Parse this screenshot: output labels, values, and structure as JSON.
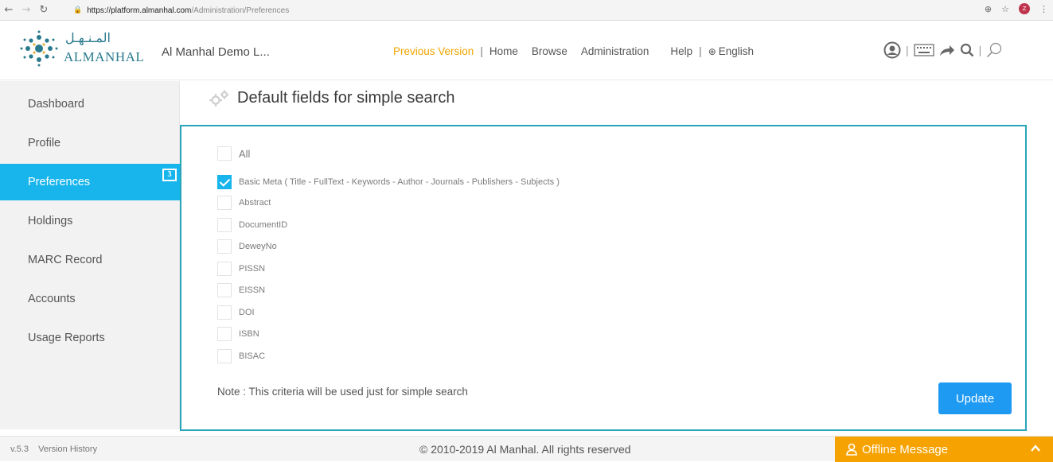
{
  "browser": {
    "url_host": "https://platform.almanhal.com",
    "url_path": "/Administration/Preferences",
    "profile_initial": "Z"
  },
  "header": {
    "logo_ar": "المـنـهـل",
    "logo_en": "ALMANHAL",
    "institution": "Al Manhal Demo L...",
    "nav": {
      "previous": "Previous Version",
      "home": "Home",
      "browse": "Browse",
      "administration": "Administration",
      "help": "Help",
      "language": "English"
    }
  },
  "sidebar": {
    "items": [
      {
        "label": "Dashboard"
      },
      {
        "label": "Profile"
      },
      {
        "label": "Preferences"
      },
      {
        "label": "Holdings"
      },
      {
        "label": "MARC Record"
      },
      {
        "label": "Accounts"
      },
      {
        "label": "Usage Reports"
      }
    ],
    "active_index": 2,
    "badge": "3"
  },
  "main": {
    "title": "Default fields for simple search",
    "fields": [
      {
        "label": "All",
        "checked": false
      },
      {
        "label": "Basic Meta ( Title - FullText - Keywords - Author - Journals - Publishers - Subjects )",
        "checked": true
      },
      {
        "label": "Abstract",
        "checked": false
      },
      {
        "label": "DocumentID",
        "checked": false
      },
      {
        "label": "DeweyNo",
        "checked": false
      },
      {
        "label": "PISSN",
        "checked": false
      },
      {
        "label": "EISSN",
        "checked": false
      },
      {
        "label": "DOI",
        "checked": false
      },
      {
        "label": "ISBN",
        "checked": false
      },
      {
        "label": "BISAC",
        "checked": false
      }
    ],
    "note": "Note : This criteria will be used just for simple search",
    "update_label": "Update"
  },
  "footer": {
    "version": "v.5.3",
    "version_history": "Version History",
    "copyright": "© 2010-2019 Al Manhal. All rights reserved",
    "offline_message": "Offline Message"
  },
  "colors": {
    "accent": "#18b5ec",
    "panel_border": "#2aa4b9",
    "nav_highlight": "#f0a500",
    "offline_bg": "#f6a200",
    "button": "#1e9af3"
  }
}
